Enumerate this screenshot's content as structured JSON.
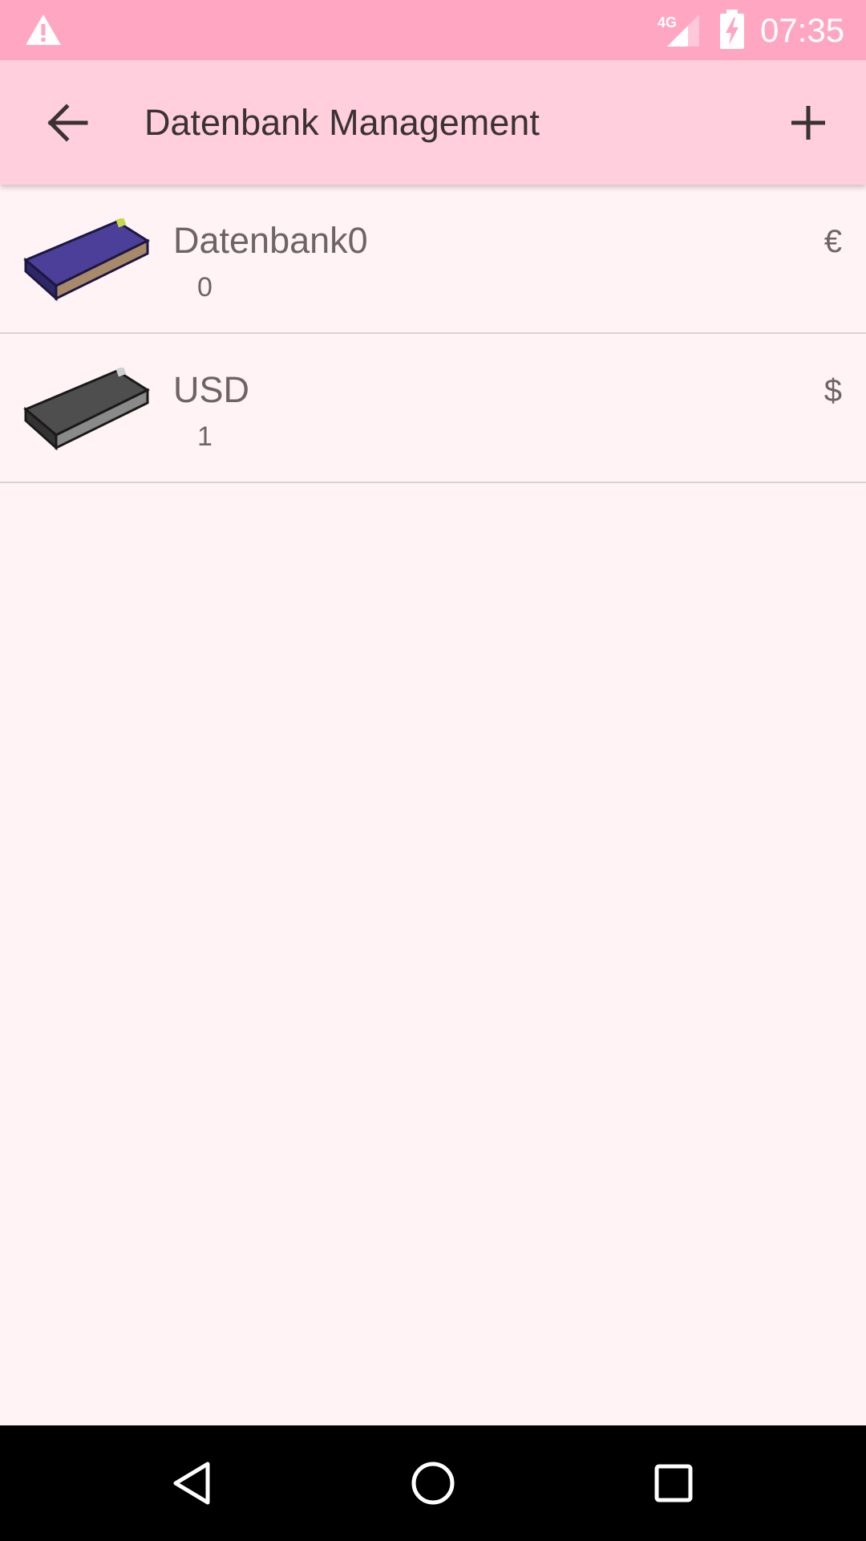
{
  "status_bar": {
    "time": "07:35",
    "network": "4G",
    "icons": [
      "warning-icon",
      "signal-icon",
      "battery-charging-icon"
    ]
  },
  "app_bar": {
    "title": "Datenbank Management",
    "back_icon": "arrow-back-icon",
    "add_icon": "plus-icon"
  },
  "databases": [
    {
      "name": "Datenbank0",
      "index": "0",
      "currency": "€",
      "icon": "book-blue-icon",
      "cover_color": "#4b3f9a",
      "pages_color": "#a88a6a"
    },
    {
      "name": "USD",
      "index": "1",
      "currency": "$",
      "icon": "book-gray-icon",
      "cover_color": "#4e4e4e",
      "pages_color": "#8a8a8a"
    }
  ],
  "nav_bar": {
    "icons": [
      "back-triangle-icon",
      "home-circle-icon",
      "recents-square-icon"
    ]
  },
  "colors": {
    "status_bar": "#ffa6c2",
    "app_bar": "#ffcfdd",
    "background": "#fff3f5"
  }
}
